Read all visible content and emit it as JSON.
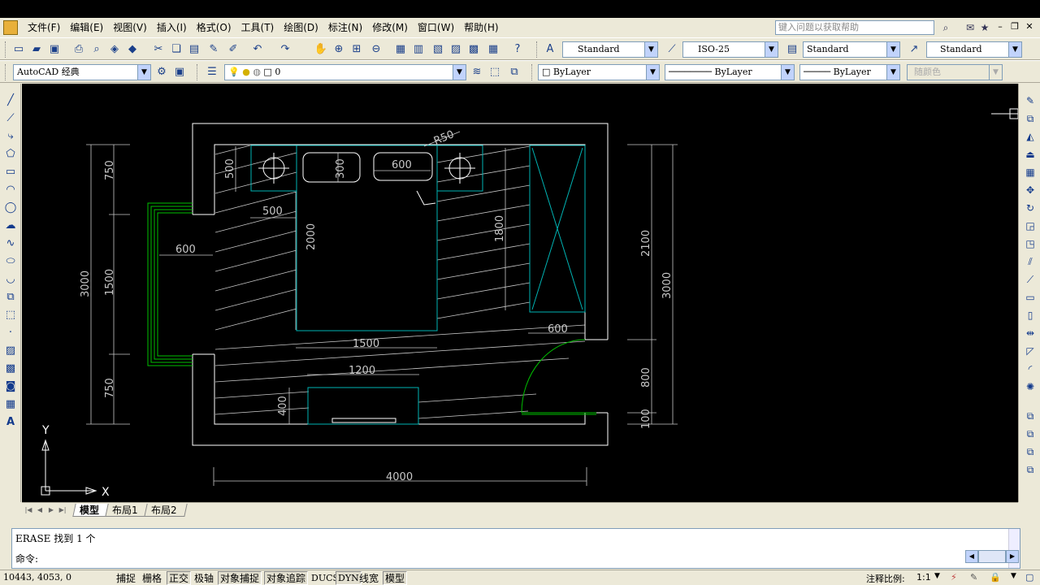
{
  "menubar": {
    "items": [
      "文件(F)",
      "编辑(E)",
      "视图(V)",
      "插入(I)",
      "格式(O)",
      "工具(T)",
      "绘图(D)",
      "标注(N)",
      "修改(M)",
      "窗口(W)",
      "帮助(H)"
    ],
    "help_search_placeholder": "键入问题以获取帮助"
  },
  "styles_toolbar": {
    "text_style": "Standard",
    "dim_style": "ISO-25",
    "table_style": "Standard",
    "multileader_style": "Standard"
  },
  "layers_toolbar": {
    "workspace": "AutoCAD 经典",
    "layer": "0",
    "color": "ByLayer",
    "linetype": "ByLayer",
    "lineweight": "ByLayer",
    "plot_style": "随颜色"
  },
  "drawing": {
    "dims": {
      "d750_top": "750",
      "d1500": "1500",
      "d750_bot": "750",
      "d3000_left": "3000",
      "d500_top": "500",
      "d300": "300",
      "d600_top": "600",
      "r50": "R50",
      "d500_side": "500",
      "d600_left": "600",
      "d2000": "2000",
      "d1800": "1800",
      "d600_right": "600",
      "d1500_h": "1500",
      "d1200": "1200",
      "d400": "400",
      "d4000": "4000",
      "d2100": "2100",
      "d3000_right": "3000",
      "d800": "800",
      "d100": "100"
    },
    "ucs": {
      "x": "X",
      "y": "Y"
    },
    "colors": {
      "wall": "#ffffff",
      "furniture": "#00b4b4",
      "window": "#00c000",
      "hatch": "#c8c8c8",
      "dim": "#c8c8c8"
    }
  },
  "layout_tabs": [
    "模型",
    "布局1",
    "布局2"
  ],
  "command": {
    "history": "ERASE 找到 1 个",
    "prompt": "命令:"
  },
  "status": {
    "coords": "10443, 4053, 0",
    "toggles": [
      "捕捉",
      "栅格",
      "正交",
      "极轴",
      "对象捕捉",
      "对象追踪",
      "DUCS",
      "DYN",
      "线宽",
      "模型"
    ],
    "annotation_scale_label": "注释比例:",
    "annotation_scale": "1:1"
  }
}
